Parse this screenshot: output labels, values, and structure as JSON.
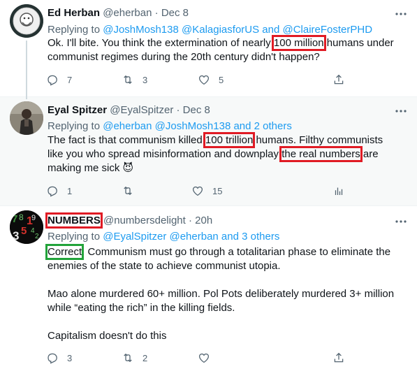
{
  "tweets": [
    {
      "name": "Ed Herban",
      "handle": "@eherban",
      "sep": "·",
      "date": "Dec 8",
      "reply_prefix": "Replying to",
      "reply_links": "@JoshMosh138 @KalagiasforUS and @ClaireFosterPHD",
      "text_before": "Ok. I'll bite. You think the extermination of nearly ",
      "text_hl": "100 million",
      "text_after": " humans under communist regimes during the 20th century didn't happen?",
      "replies": "7",
      "retweets": "3",
      "likes": "5"
    },
    {
      "name": "Eyal Spitzer",
      "handle": "@EyalSpitzer",
      "sep": "·",
      "date": "Dec 8",
      "reply_prefix": "Replying to",
      "reply_links": "@eherban @JoshMosh138 and 2 others",
      "text_a": "The fact is that communism killed ",
      "text_hl1": "100 trillion",
      "text_b": " humans. Filthy communists like you who spread misinformation and downplay ",
      "text_hl2": "the real numbers",
      "text_c": " are making me sick ",
      "emoji": "😈",
      "replies": "1",
      "retweets": "",
      "likes": "15"
    },
    {
      "name": "NUMBERS",
      "handle": "@numbersdelight",
      "sep": "·",
      "date": "20h",
      "reply_prefix": "Replying to",
      "reply_links": "@EyalSpitzer @eherban and 3 others",
      "text_hl": "Correct",
      "text_p1": ". Communism must go through a totalitarian phase to eliminate the enemies of the state to achieve communist utopia.",
      "text_p2": "Mao alone murdered 60+ million. Pol Pots deliberately murdered 3+ million while “eating the rich” in the killing fields.",
      "text_p3": "Capitalism doesn't do this",
      "replies": "3",
      "retweets": "2",
      "likes": ""
    }
  ],
  "avatar3_digits": "78 1 3 5 42",
  "colors": {
    "accent": "#1d9bf0",
    "highlight_red": "#e01b24",
    "highlight_green": "#22a33a",
    "muted": "#536471"
  }
}
